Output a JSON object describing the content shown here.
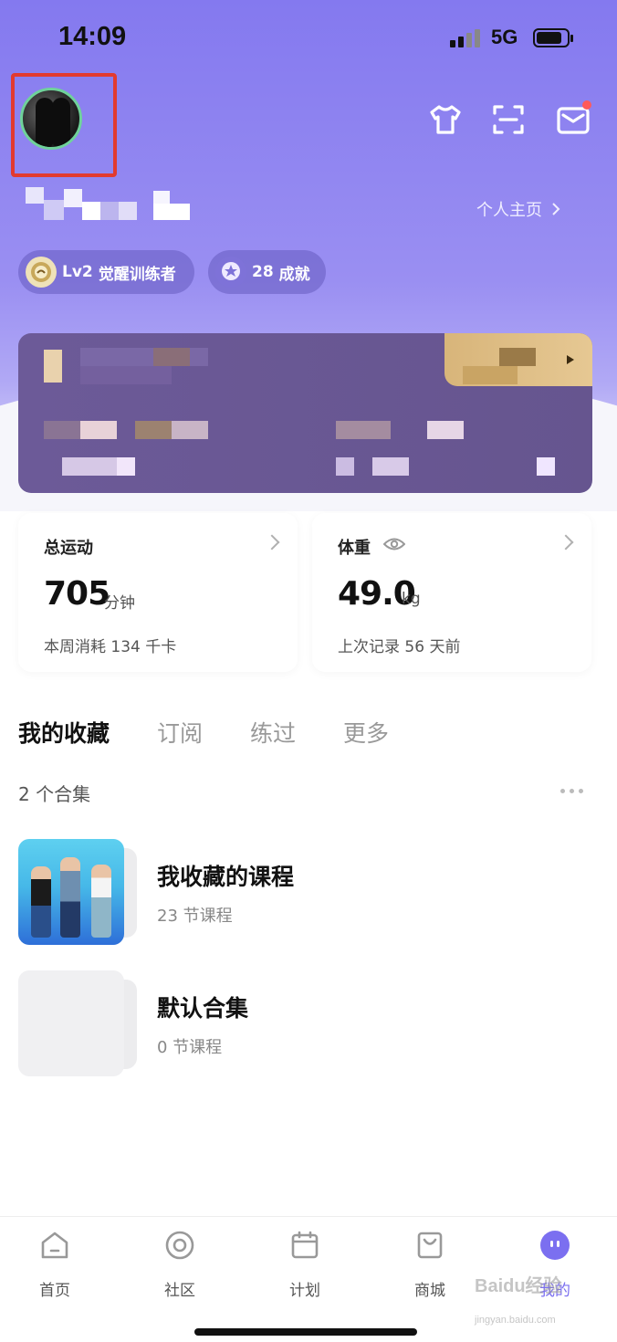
{
  "status_bar": {
    "time": "14:09",
    "network": "5G",
    "battery_level": 0.85
  },
  "header": {
    "profile_link_label": "个人主页",
    "icons": [
      "tshirt-icon",
      "scan-icon",
      "mail-icon"
    ],
    "mail_has_notification": true
  },
  "badges": {
    "level": {
      "tier": "Lv2",
      "title": "觉醒训练者"
    },
    "achievements": {
      "count": "28",
      "label": "成就"
    }
  },
  "stats": {
    "exercise": {
      "title": "总运动",
      "value": "705",
      "unit": "分钟",
      "sub": "本周消耗 134 千卡"
    },
    "weight": {
      "title": "体重",
      "value": "49.0",
      "unit": "kg",
      "sub": "上次记录 56 天前"
    }
  },
  "tabs": [
    {
      "label": "我的收藏",
      "active": true
    },
    {
      "label": "订阅",
      "active": false
    },
    {
      "label": "练过",
      "active": false
    },
    {
      "label": "更多",
      "active": false
    }
  ],
  "collections_count": "2 个合集",
  "collections": [
    {
      "name": "我收藏的课程",
      "sub": "23 节课程"
    },
    {
      "name": "默认合集",
      "sub": "0 节课程"
    }
  ],
  "tabbar": [
    {
      "label": "首页",
      "icon": "home-icon",
      "active": false
    },
    {
      "label": "社区",
      "icon": "community-icon",
      "active": false
    },
    {
      "label": "计划",
      "icon": "calendar-icon",
      "active": false
    },
    {
      "label": "商城",
      "icon": "shop-icon",
      "active": false
    },
    {
      "label": "我的",
      "icon": "profile-icon",
      "active": true
    }
  ],
  "colors": {
    "accent": "#7b6ff0",
    "highlight_box": "#e23a2f",
    "notification_dot": "#ff5a5a"
  },
  "watermark": {
    "brand": "Baidu经验",
    "url": "jingyan.baidu.com"
  }
}
